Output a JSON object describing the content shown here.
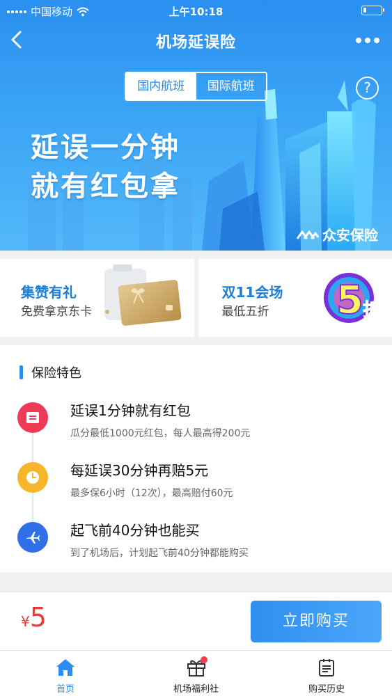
{
  "status_bar": {
    "carrier": "中国移动",
    "time": "上午10:18"
  },
  "nav": {
    "title": "机场延误险"
  },
  "flight_tabs": [
    {
      "label": "国内航班",
      "active": true
    },
    {
      "label": "国际航班",
      "active": false
    }
  ],
  "help": {
    "symbol": "?"
  },
  "banner": {
    "slogan_line1": "延误一分钟",
    "slogan_line2": "就有红包拿",
    "brand": "众安保险"
  },
  "promos": [
    {
      "title": "集赞有礼",
      "subtitle": "免费拿京东卡"
    },
    {
      "title": "双11会场",
      "subtitle": "最低五折",
      "badge_number": "5",
      "badge_text": "折"
    }
  ],
  "features": {
    "section_title": "保险特色",
    "items": [
      {
        "title": "延误1分钟就有红包",
        "desc": "瓜分最低1000元红包，每人最高得200元",
        "icon": "red-envelope-icon",
        "color": "#ee3a57"
      },
      {
        "title": "每延误30分钟再赔5元",
        "desc": "最多保6小时（12次），最高赔付60元",
        "icon": "clock-icon",
        "color": "#f7b52c"
      },
      {
        "title": "起飞前40分钟也能买",
        "desc": "到了机场后，计划起飞前40分钟都能购买",
        "icon": "airplane-icon",
        "color": "#2f6fe8"
      }
    ]
  },
  "purchase": {
    "currency": "¥",
    "price": "5",
    "button_label": "立即购买"
  },
  "tabbar": [
    {
      "label": "首页",
      "icon": "home-icon",
      "active": true
    },
    {
      "label": "机场福利社",
      "icon": "gift-icon",
      "badge": true
    },
    {
      "label": "购买历史",
      "icon": "history-icon"
    }
  ],
  "colors": {
    "primary": "#2b8ef0",
    "price": "#e83a3a"
  }
}
